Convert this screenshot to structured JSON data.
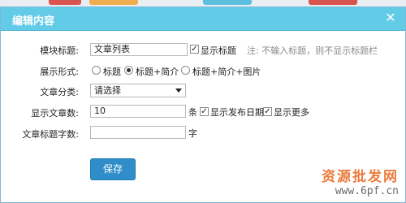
{
  "dialog": {
    "title": "编辑内容",
    "close_glyph": "✕"
  },
  "form": {
    "module_title": {
      "label": "模块标题:",
      "value": "文章列表",
      "show_title_checked": true,
      "show_title_label": "显示标题",
      "note": "注: 不输入标题，则不显示标题栏"
    },
    "display_format": {
      "label": "展示形式:",
      "options": [
        "标题",
        "标题+简介",
        "标题+简介+图片"
      ],
      "selected_index": 1
    },
    "category": {
      "label": "文章分类:",
      "selected": "请选择"
    },
    "article_count": {
      "label": "显示文章数:",
      "value": "10",
      "unit": "条",
      "show_date_checked": true,
      "show_date_label": "显示发布日期",
      "show_more_checked": true,
      "show_more_label": "显示更多"
    },
    "title_chars": {
      "label": "文章标题字数:",
      "value": "",
      "unit": "字"
    }
  },
  "actions": {
    "save_label": "保存"
  },
  "watermark": {
    "line1": "资源批发网",
    "line2": "www.6pf.cn"
  },
  "colors": {
    "titlebar": "#62cbe8",
    "save_button": "#2f8ec9",
    "watermark": "#e86e2a"
  }
}
